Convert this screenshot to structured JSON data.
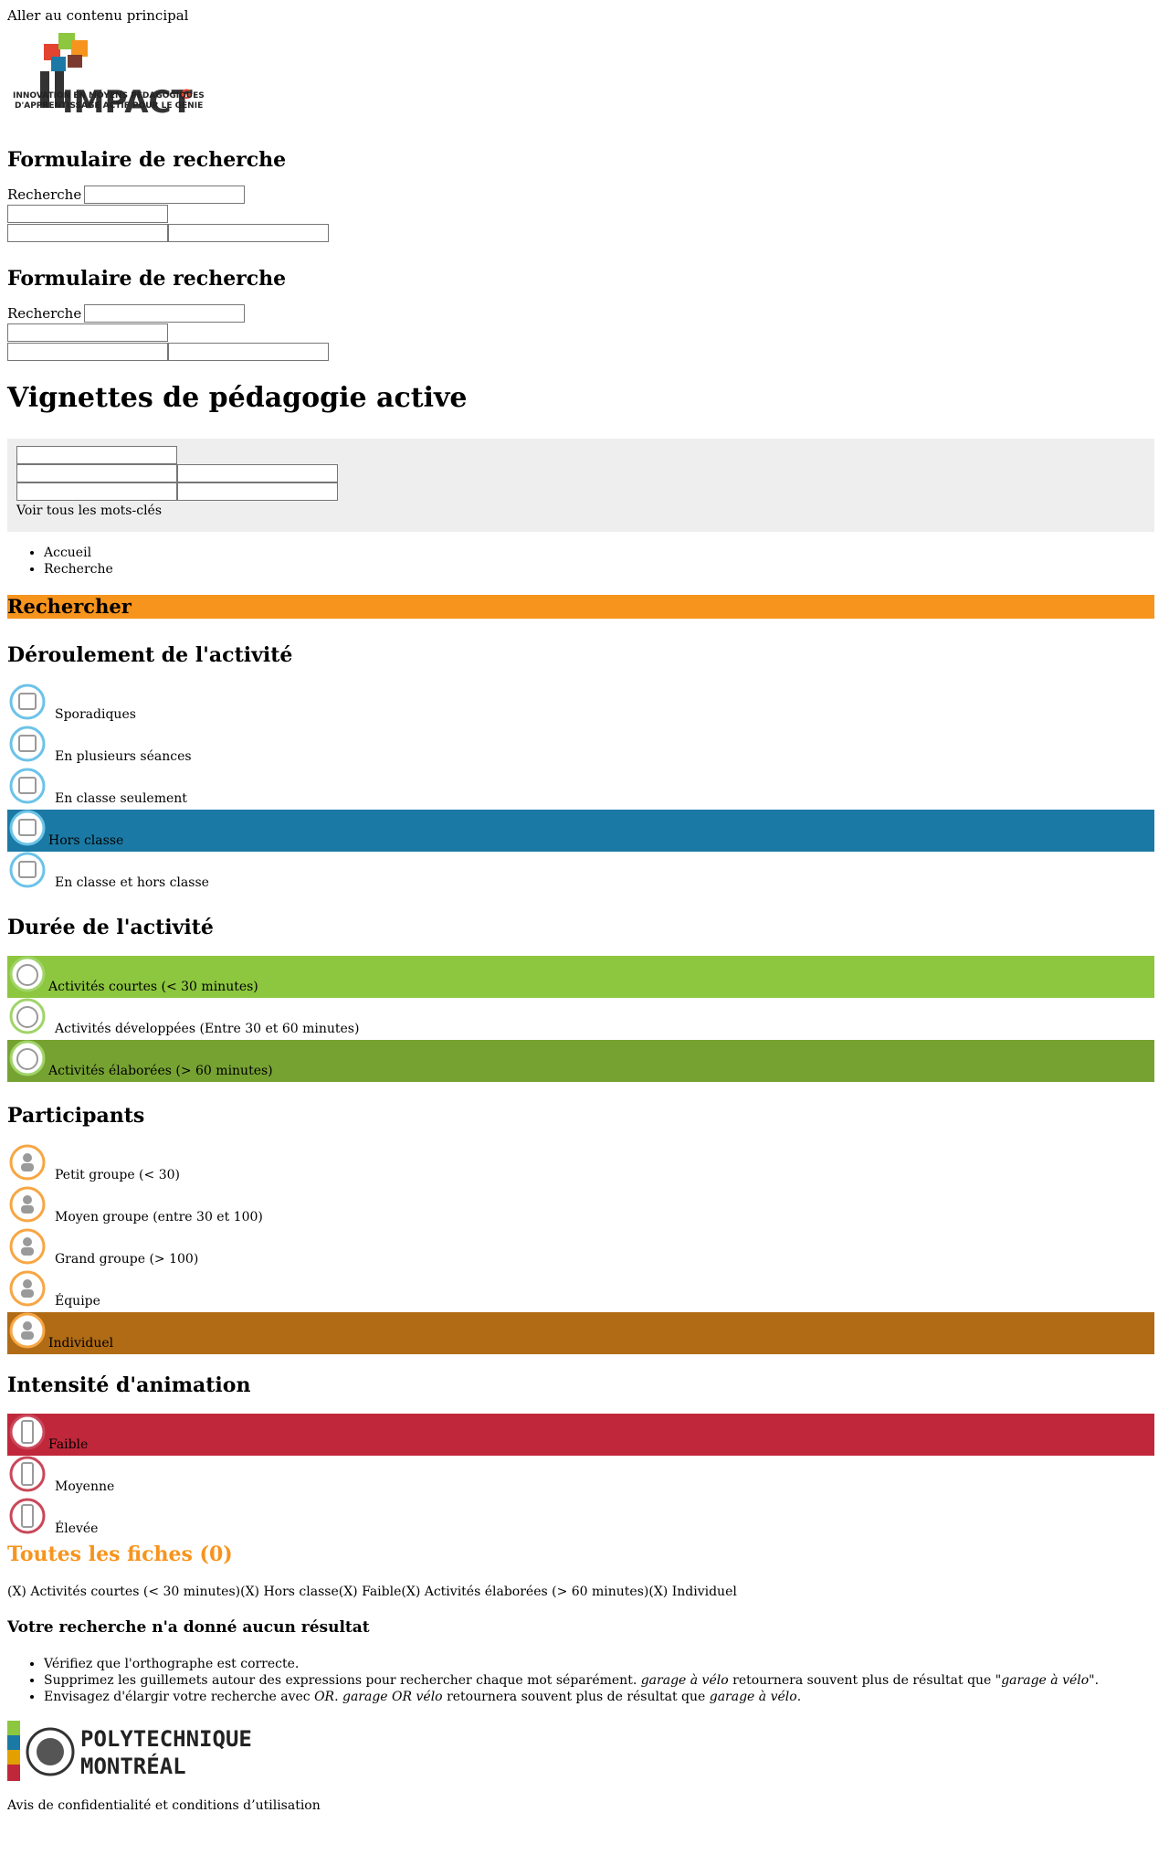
{
  "skip_link": "Aller au contenu principal",
  "logo": {
    "wordmark": "IMPACT",
    "superscript": "G",
    "tagline_line1": "INNOVATION EN MOYENS PÉDAGOGIQUES",
    "tagline_line2": "D'APPRENTISSAGE ACTIF POUR LE GÉNIE"
  },
  "search_forms": [
    {
      "title": "Formulaire de recherche",
      "label": "Recherche"
    },
    {
      "title": "Formulaire de recherche",
      "label": "Recherche"
    }
  ],
  "page_title": "Vignettes de pédagogie active",
  "keywords_link": "Voir tous les mots-clés",
  "breadcrumb": [
    "Accueil",
    "Recherche"
  ],
  "search_bar_title": "Rechercher",
  "facets": {
    "deroulement": {
      "title": "Déroulement de l'activité",
      "items": [
        {
          "label": "Sporadiques",
          "icon": "calendar-dots-icon",
          "selected": false
        },
        {
          "label": "En plusieurs séances",
          "icon": "calendar-plus-icon",
          "selected": false
        },
        {
          "label": "En classe seulement",
          "icon": "classroom-icon",
          "selected": false
        },
        {
          "label": "Hors classe",
          "icon": "tree-icon",
          "selected": true
        },
        {
          "label": "En classe et hors classe",
          "icon": "class-and-outside-icon",
          "selected": false
        }
      ]
    },
    "duree": {
      "title": "Durée de l'activité",
      "items": [
        {
          "label": "Activités courtes (< 30 minutes)",
          "icon": "timer-lt30-icon",
          "selected": true
        },
        {
          "label": "Activités développées (Entre 30 et 60 minutes)",
          "icon": "timer-30-60-icon",
          "selected": false
        },
        {
          "label": "Activités élaborées (> 60 minutes)",
          "icon": "timer-gt60-icon",
          "selected": true
        }
      ]
    },
    "participants": {
      "title": "Participants",
      "items": [
        {
          "label": "Petit groupe (< 30)",
          "icon": "small-group-icon",
          "selected": false
        },
        {
          "label": "Moyen groupe (entre 30 et 100)",
          "icon": "medium-group-icon",
          "selected": false
        },
        {
          "label": "Grand groupe (> 100)",
          "icon": "large-group-icon",
          "selected": false
        },
        {
          "label": "Équipe",
          "icon": "team-icon",
          "selected": false
        },
        {
          "label": "Individuel",
          "icon": "individual-icon",
          "selected": true
        }
      ]
    },
    "intensite": {
      "title": "Intensité d'animation",
      "items": [
        {
          "label": "Faible",
          "icon": "battery-low-icon",
          "selected": true
        },
        {
          "label": "Moyenne",
          "icon": "battery-medium-icon",
          "selected": false
        },
        {
          "label": "Élevée",
          "icon": "battery-high-icon",
          "selected": false
        }
      ]
    }
  },
  "results_title": "Toutes les fiches (0)",
  "active_filters": [
    "(X) Activités courtes (< 30 minutes)",
    "(X) Hors classe",
    "(X) Faible",
    "(X) Activités élaborées (> 60 minutes)",
    "(X) Individuel"
  ],
  "no_results_title": "Votre recherche n'a donné aucun résultat",
  "tips": {
    "t1": "Vérifiez que l'orthographe est correcte.",
    "t2_a": "Supprimez les guillemets autour des expressions pour rechercher chaque mot séparément. ",
    "t2_b": "garage à vélo",
    "t2_c": " retournera souvent plus de résultat que ",
    "t2_d": "\"garage à vélo\"",
    "t2_e": ".",
    "t3_a": "Envisagez d'élargir votre recherche avec ",
    "t3_b": "OR",
    "t3_c": ". ",
    "t3_d": "garage OR vélo",
    "t3_e": " retournera souvent plus de résultat que ",
    "t3_f": "garage à vélo",
    "t3_g": "."
  },
  "footer_logo": {
    "line1": "POLYTECHNIQUE",
    "line2": "MONTRÉAL"
  },
  "footer_link": "Avis de confidentialité et conditions d’utilisation",
  "colors": {
    "orange": "#f7941d",
    "blue_selected": "#1b7aa5",
    "green_selected_light": "#8dc63f",
    "green_selected_dark": "#76a232",
    "brown_selected": "#b06b14",
    "red_selected": "#c1273a"
  }
}
